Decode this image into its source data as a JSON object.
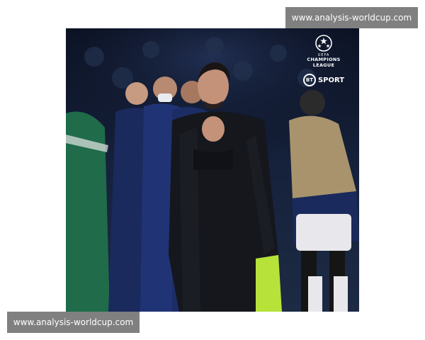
{
  "watermarks": {
    "top": "www.analysis-worldcup.com",
    "bottom": "www.analysis-worldcup.com"
  },
  "branding": {
    "uefa": "UEFA",
    "competition": "CHAMPIONS",
    "competition_line2": "LEAGUE",
    "broadcaster_logo": "BT",
    "broadcaster_name": "SPORT"
  },
  "photo": {
    "subject_icon": "coach-praying-figure",
    "background_colors": [
      "#0c1220",
      "#1b2a4a",
      "#2e4170"
    ],
    "accent_colors": {
      "coat": "#15171d",
      "green_kit": "#1f6b4a",
      "tan_bib": "#a8936d",
      "white_shorts": "#e8e8ec",
      "hi_vis": "#b6e23a"
    }
  }
}
